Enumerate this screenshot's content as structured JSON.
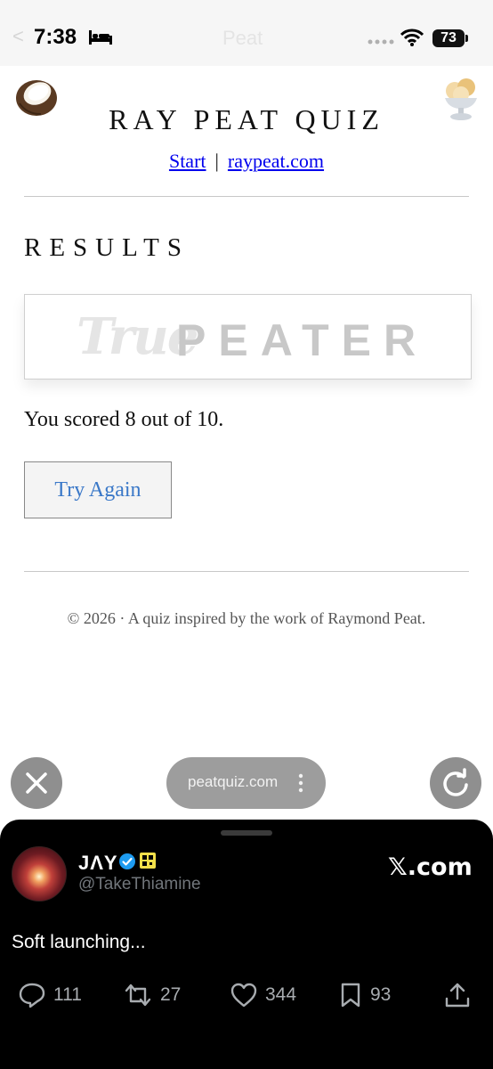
{
  "status_bar": {
    "time": "7:38",
    "battery": "73",
    "ghost_title": "Peat",
    "back": "<"
  },
  "site": {
    "title": "RAY PEAT QUIZ",
    "nav_start": "Start",
    "nav_separator": "|",
    "nav_site": "raypeat.com"
  },
  "results": {
    "heading": "RESULTS",
    "badge_true": "True",
    "badge_peater": "PEATER",
    "score_text": "You scored 8 out of 10.",
    "try_again_label": "Try Again"
  },
  "footer": {
    "text": "© 2026 · A quiz inspired by the work of Raymond Peat."
  },
  "browser": {
    "url": "peatquiz.com"
  },
  "tweet": {
    "display_name": "JΛY",
    "handle": "@TakeThiamine",
    "source": "𝕏.com",
    "text": "Soft launching...",
    "replies": "111",
    "retweets": "27",
    "likes": "344",
    "bookmarks": "93"
  },
  "icons": {
    "status": [
      "bed-icon",
      "signal-icon",
      "wifi-icon",
      "battery-icon"
    ],
    "page": [
      "coconut-icon",
      "ice-cream-sundae-icon"
    ],
    "browser": [
      "close-icon",
      "more-dots-icon",
      "reload-icon"
    ],
    "tweet": [
      "verified-badge-icon",
      "qr-badge-icon",
      "reply-icon",
      "retweet-icon",
      "like-icon",
      "bookmark-icon",
      "share-icon"
    ]
  },
  "colors": {
    "link": "#0000ee",
    "button_text": "#3a78c8",
    "verified": "#1d9bf0",
    "sheet_background": "#000000"
  }
}
